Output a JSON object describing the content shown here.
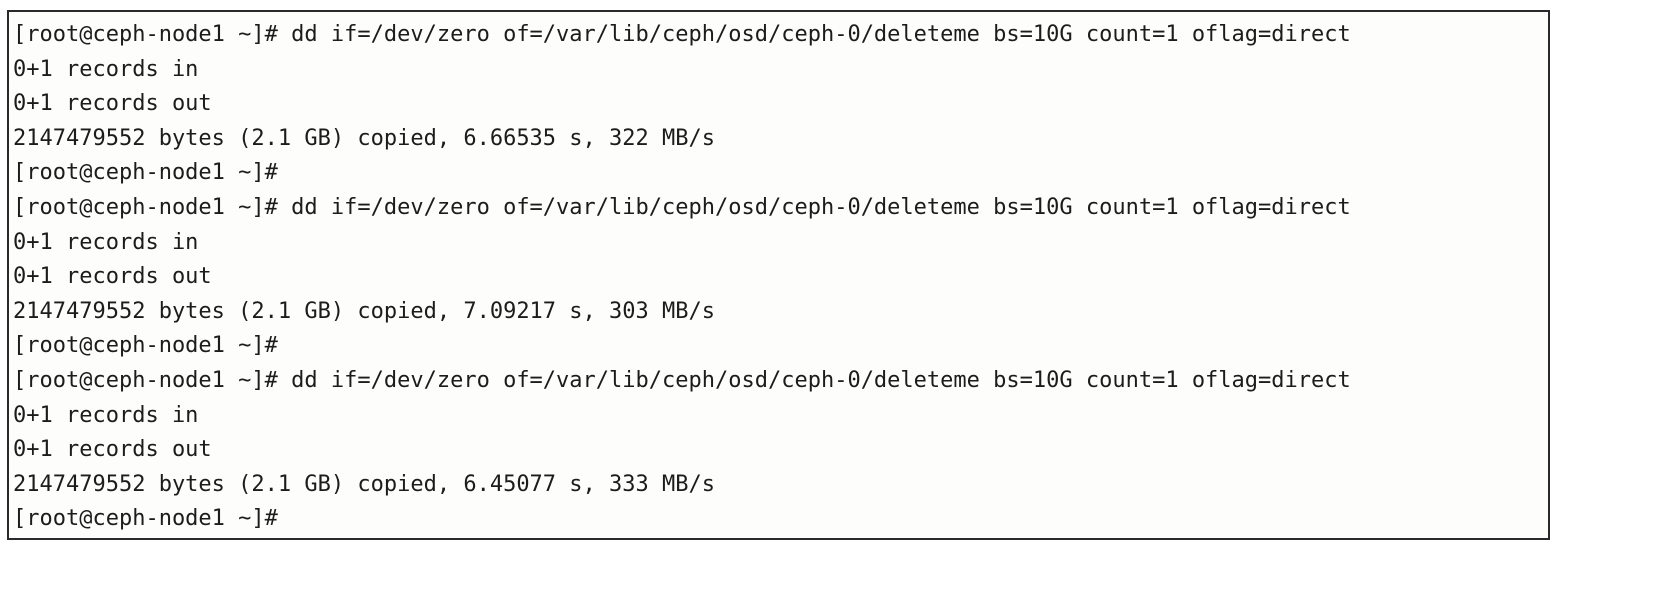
{
  "terminal": {
    "lines": [
      "[root@ceph-node1 ~]# dd if=/dev/zero of=/var/lib/ceph/osd/ceph-0/deleteme bs=10G count=1 oflag=direct",
      "0+1 records in",
      "0+1 records out",
      "2147479552 bytes (2.1 GB) copied, 6.66535 s, 322 MB/s",
      "[root@ceph-node1 ~]#",
      "[root@ceph-node1 ~]# dd if=/dev/zero of=/var/lib/ceph/osd/ceph-0/deleteme bs=10G count=1 oflag=direct",
      "0+1 records in",
      "0+1 records out",
      "2147479552 bytes (2.1 GB) copied, 7.09217 s, 303 MB/s",
      "[root@ceph-node1 ~]#",
      "[root@ceph-node1 ~]# dd if=/dev/zero of=/var/lib/ceph/osd/ceph-0/deleteme bs=10G count=1 oflag=direct",
      "0+1 records in",
      "0+1 records out",
      "2147479552 bytes (2.1 GB) copied, 6.45077 s, 333 MB/s",
      "[root@ceph-node1 ~]#"
    ]
  },
  "colors": {
    "text": "#1c1c1c",
    "background": "#fdfdfb",
    "border": "#2a2a2a"
  }
}
